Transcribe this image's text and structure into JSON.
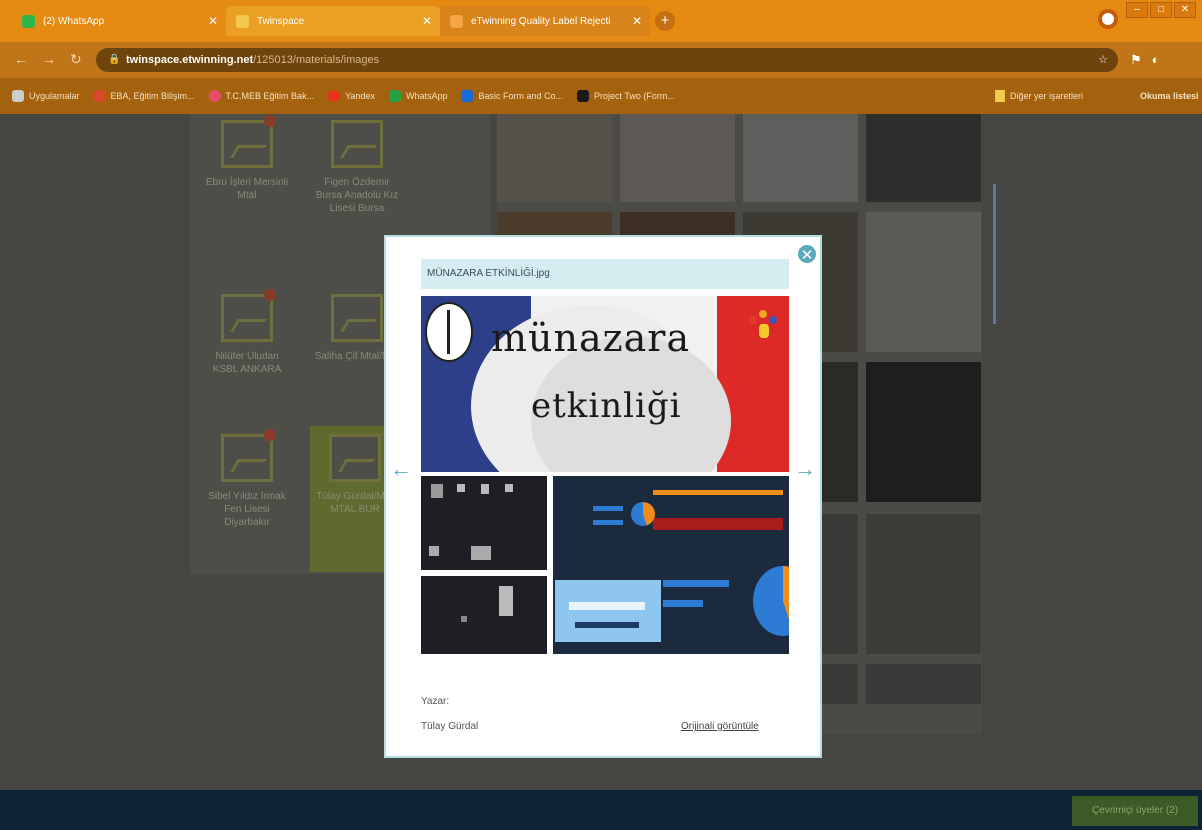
{
  "browser": {
    "tabs": [
      {
        "label": "(2) WhatsApp",
        "icon": "whatsapp-icon"
      },
      {
        "label": "Twinspace",
        "icon": "twinspace-icon"
      },
      {
        "label": "eTwinning Quality Label Rejecti",
        "icon": "etwinning-icon"
      }
    ],
    "url_host": "twinspace.etwinning.net",
    "url_path": "/125013/materials/images",
    "bookmarks": [
      {
        "label": "Uygulamalar",
        "icon": "apps-grid-icon",
        "color": "#cccccc"
      },
      {
        "label": "EBA, Eğitim Bilişim...",
        "icon": "eba-icon",
        "color": "#d44a2a"
      },
      {
        "label": "T.C.MEB Eğitim Bak...",
        "icon": "meb-icon",
        "color": "#e84c6c"
      },
      {
        "label": "Yandex",
        "icon": "yandex-icon",
        "color": "#e8321a"
      },
      {
        "label": "WhatsApp",
        "icon": "whatsapp-icon",
        "color": "#25a244"
      },
      {
        "label": "Basic Form and Co...",
        "icon": "behance-icon",
        "color": "#1a6ad8"
      },
      {
        "label": "Project Two (Form...",
        "icon": "project-icon",
        "color": "#1a1a1a"
      }
    ],
    "other_bookmarks": "Diğer yer işaretleri",
    "reading_list": "Okuma listesi"
  },
  "materials": [
    {
      "title": "Ebru İşleri Mersinli Mtal"
    },
    {
      "title": "Figen Özdemir Bursa Anadolu Kız Lisesi Bursa"
    },
    {
      "title": "Nilüfer Uludan KSBL ANKARA"
    },
    {
      "title": "Saliha Çif Mtal/Mer"
    },
    {
      "title": "Sibel Yıldız Irmak Fen Lisesi Diyarbakır"
    },
    {
      "title": "Tülay Gürdal/Mer MTAL BUR"
    }
  ],
  "modal": {
    "title": "MÜNAZARA ETKİNLİĞİ.jpg",
    "hero_line1": "münazara",
    "hero_line2": "etkinliği",
    "author_label": "Yazar:",
    "author_name": "Tülay Gürdal",
    "original_link": "Orijinali görüntüle",
    "accent_color": "#5aaab8"
  },
  "footer": {
    "language_button": "Çevrimiçi üyeler (2)"
  }
}
